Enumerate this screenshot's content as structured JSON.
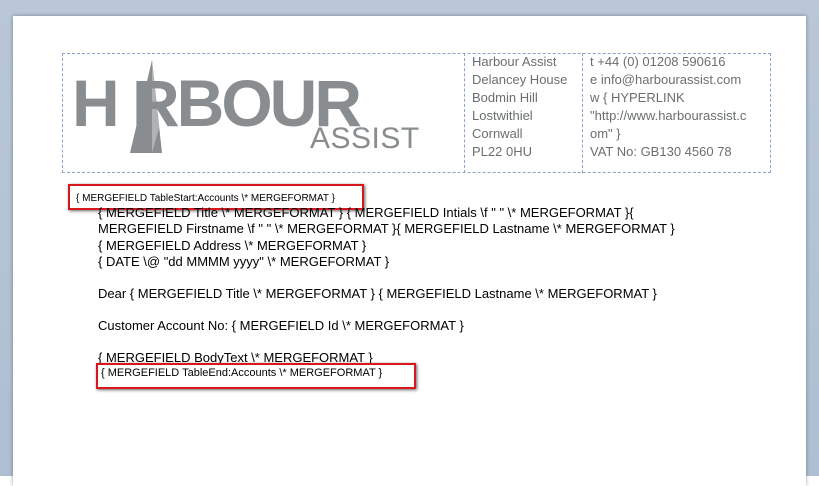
{
  "logo": {
    "main": "H RBOUR",
    "sub": "ASSIST"
  },
  "address": {
    "lines": [
      "Harbour Assist",
      "Delancey House",
      "Bodmin Hill",
      "Lostwithiel",
      "Cornwall",
      "PL22 0HU"
    ]
  },
  "contact": {
    "phone": "t  +44 (0) 01208 590616",
    "email": "e  info@harbourassist.com",
    "web1": "w  { HYPERLINK",
    "web2": "\"http://www.harbourassist.c",
    "web3": "om\" }",
    "vat": "VAT No: GB130 4560 78"
  },
  "fields": {
    "table_start": "{ MERGEFIELD  TableStart:Accounts  \\* MERGEFORMAT }",
    "line1": "{ MERGEFIELD  Title  \\* MERGEFORMAT } { MERGEFIELD  Intials \\f \" \"  \\* MERGEFORMAT }{",
    "line2": "MERGEFIELD  Firstname \\f \" \"  \\* MERGEFORMAT }{ MERGEFIELD  Lastname  \\* MERGEFORMAT }",
    "line3": "{ MERGEFIELD  Address  \\* MERGEFORMAT }",
    "line4": "{ DATE  \\@ \"dd MMMM yyyy\"  \\* MERGEFORMAT }",
    "dear": "Dear { MERGEFIELD  Title  \\* MERGEFORMAT } { MERGEFIELD  Lastname   \\* MERGEFORMAT }",
    "account": "Customer Account No: { MERGEFIELD  Id  \\* MERGEFORMAT }",
    "body": "{ MERGEFIELD  BodyText  \\* MERGEFORMAT }",
    "table_end": "{ MERGEFIELD  TableEnd:Accounts  \\* MERGEFORMAT }"
  },
  "colors": {
    "highlight": "#d8171c",
    "logo": "#898d90",
    "border": "#8aa5c8"
  }
}
